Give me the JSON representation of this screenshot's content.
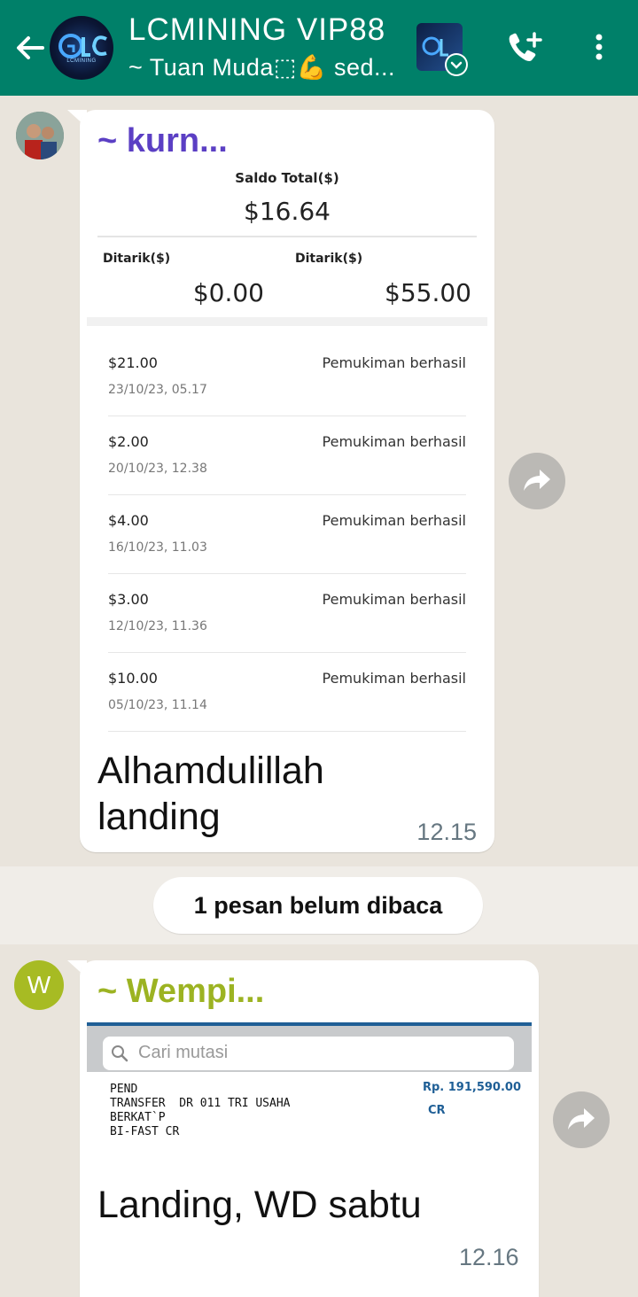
{
  "header": {
    "title": "LCMINING VIP88",
    "subtitle": "~ Tuan Muda⬚💪 sed...",
    "avatar_logo_text": "LCMINING"
  },
  "messages": [
    {
      "sender": "~ kurn...",
      "sender_color": "#5b3fc4",
      "screenshot": {
        "balance_label": "Saldo Total($)",
        "balance_value": "$16.64",
        "withdrawn_left_label": "Ditarik($)",
        "withdrawn_left_value": "$0.00",
        "withdrawn_right_label": "Ditarik($)",
        "withdrawn_right_value": "$55.00",
        "transactions": [
          {
            "amount": "$21.00",
            "status": "Pemukiman berhasil",
            "date": "23/10/23, 05.17"
          },
          {
            "amount": "$2.00",
            "status": "Pemukiman berhasil",
            "date": "20/10/23, 12.38"
          },
          {
            "amount": "$4.00",
            "status": "Pemukiman berhasil",
            "date": "16/10/23, 11.03"
          },
          {
            "amount": "$3.00",
            "status": "Pemukiman berhasil",
            "date": "12/10/23, 11.36"
          },
          {
            "amount": "$10.00",
            "status": "Pemukiman berhasil",
            "date": "05/10/23, 11.14"
          }
        ]
      },
      "text_line1": "Alhamdulillah",
      "text_line2": "landing",
      "time": "12.15"
    },
    {
      "sender": "~ Wempi...",
      "sender_color": "#9cb322",
      "avatar_initial": "W",
      "avatar_color": "#a7bb23",
      "screenshot": {
        "search_placeholder": "Cari mutasi",
        "line1": "PEND",
        "line2": "TRANSFER  DR 011 TRI USAHA",
        "line3": "BERKAT`P",
        "line4": "BI-FAST CR",
        "amount": "Rp. 191,590.00",
        "type": "CR"
      },
      "text": "Landing, WD sabtu",
      "time": "12.16"
    }
  ],
  "unread_notice": "1 pesan belum dibaca"
}
